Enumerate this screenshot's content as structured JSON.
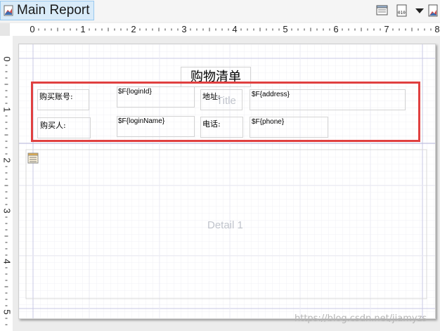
{
  "tab": {
    "label": "Main Report",
    "icon": "report-icon"
  },
  "toolbar": [
    {
      "name": "page-layout-icon"
    },
    {
      "name": "binary-data-icon",
      "text": "010"
    },
    {
      "name": "dropdown-arrow-icon"
    },
    {
      "name": "preview-icon"
    }
  ],
  "ruler": {
    "h_labels": [
      "0",
      "1",
      "2",
      "3",
      "4",
      "5",
      "6",
      "7",
      "8"
    ],
    "v_labels": [
      "0",
      "1",
      "2",
      "3",
      "4",
      "5"
    ]
  },
  "report": {
    "title_text": "购物清单",
    "title_band_label": "Title",
    "detail_band_label": "Detail 1",
    "fields": {
      "account_label": "购买账号:",
      "login_id": "$F{loginId}",
      "address_label": "地址:",
      "address": "$F{address}",
      "buyer_label": "购买人:",
      "login_name": "$F{loginName}",
      "phone_label": "电话:",
      "phone": "$F{phone}"
    }
  },
  "watermark": "https://blog.csdn.net/jiamyzs",
  "colors": {
    "selection": "#e04040",
    "tab_bg": "#d9ebf9",
    "band_label": "#c0c4cc"
  }
}
